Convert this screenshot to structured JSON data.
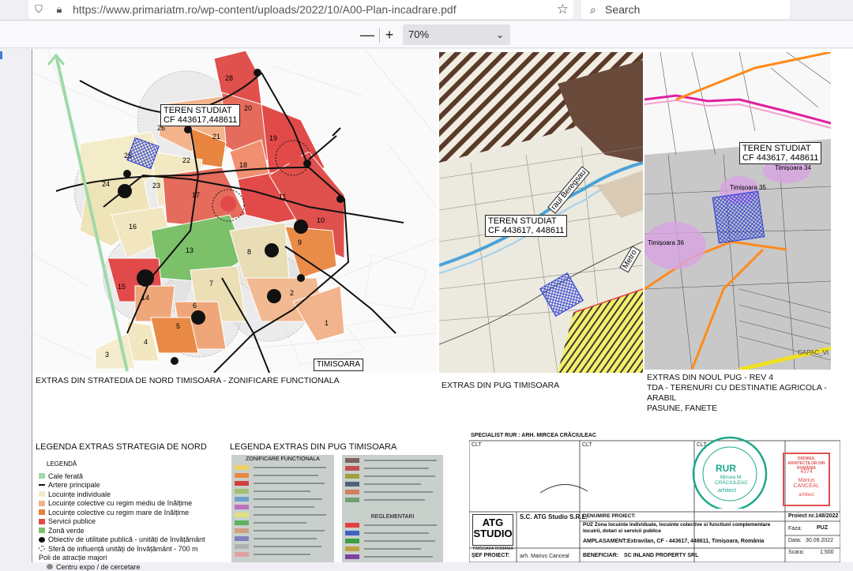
{
  "browser": {
    "url": "https://www.primariatm.ro/wp-content/uploads/2022/10/A00-Plan-incadrare.pdf",
    "search_placeholder": "Search",
    "zoom": "70%",
    "zoom_out": "—",
    "zoom_in": "+"
  },
  "map1": {
    "label_line1": "TEREN STUDIAT",
    "label_line2": "CF 443617,448611",
    "city_label": "TIMISOARA",
    "caption": "EXTRAS DIN STRATEDIA DE NORD TIMISOARA - ZONIFICARE FUNCTIONALA",
    "zones": [
      "28",
      "20",
      "26",
      "21",
      "19",
      "25",
      "22",
      "18",
      "24",
      "23",
      "17",
      "11",
      "16",
      "10",
      "13",
      "8",
      "9",
      "15",
      "14",
      "7",
      "2",
      "6",
      "5",
      "4",
      "3",
      "1"
    ]
  },
  "map2": {
    "label_line1": "TEREN STUDIAT",
    "label_line2": "CF 443617, 448611",
    "river": "raul Beregsau",
    "metro": "Metro",
    "caption": "EXTRAS DIN PUG TIMISOARA"
  },
  "map3": {
    "label_line1": "TEREN STUDIAT",
    "label_line2": "CF 443617, 448611",
    "t34": "Timișoara 34",
    "t35": "Timișoara 35",
    "t36": "Timișoara 36",
    "corner": "CAPAC_VI",
    "caption_line1": "EXTRAS DIN NOUL PUG - REV 4",
    "caption_line2": "TDA - TERENURI CU DESTINATIE AGRICOLA - ARABIL",
    "caption_line3": "PASUNE, FANETE"
  },
  "legend1": {
    "title": "LEGENDA EXTRAS STRATEGIA DE NORD",
    "subtitle": "LEGENDĂ",
    "items": [
      {
        "label": "Cale ferată",
        "color": "#9fd9a9"
      },
      {
        "label": "Artere principale",
        "color": "#111111"
      },
      {
        "label": "Locuințe individuale",
        "color": "#f3ecc8"
      },
      {
        "label": "Locuințe colective cu regim mediu de înălțime",
        "color": "#f2b48c"
      },
      {
        "label": "Locuințe colective cu regim mare de înălțime",
        "color": "#e8823a"
      },
      {
        "label": "Servicii publice",
        "color": "#e24a4a"
      },
      {
        "label": "Zonă verde",
        "color": "#7cc06a"
      },
      {
        "label": "Obiectiv de utilitate publică - unități de învățământ",
        "color": "#111111"
      },
      {
        "label": "Sferă de influență unități de învățământ - 700 m",
        "color": "#cccccc"
      },
      {
        "label": "Poli de atracție majori",
        "color": "#ffffff"
      },
      {
        "label": "Centru expo / de cercetare",
        "color": "#888888"
      }
    ]
  },
  "legend2": {
    "title": "LEGENDA EXTRAS DIN PUG TIMISOARA",
    "heading_a": "ZONIFICARE FUNCTIONALA",
    "heading_b": "REGLEMENTARI"
  },
  "titleblock": {
    "specialist": "SPECIALIST RUR : ARH. MIRCEA CRĂCIULEAC",
    "clt": "CLT",
    "company": "S.C. ATG Studio S.R.L.",
    "company_logo": "ATG STUDIO",
    "company_sub": "TIMISOARA ROMANIA",
    "project_title_label": "DENUMIRE PROIECT:",
    "project_title": "PUZ Zona locuinte individuale, locuinte colective si functiuni complementare locuirii, dotari si servicii publice",
    "location_label": "AMPLASAMENT:",
    "location": "Extravilan, CF - 443617, 448611, Timișoara, România",
    "beneficiary_label": "BENEFICIAR:",
    "beneficiary": "SC INLAND PROPERTY SRL",
    "project_no": "Proiect nr.148/2022",
    "phase_label": "Faza:",
    "phase": "PUZ",
    "date_label": "Data:",
    "date": "30.09.2022",
    "scale_label": "Scara:",
    "scale": "1:500",
    "sef_proiect": "ȘEF PROIECT:",
    "arch": "arh. Marius Canceal",
    "stamp1_line1": "RUR",
    "stamp1_line2": "Mircea M. CRĂCIULEAC",
    "stamp1_line3": "arhitect",
    "stamp2_line1": "ORDINUL ARHITECȚILOR DIN ROMÂNIA",
    "stamp2_line2": "4374",
    "stamp2_line3": "Marius CANCEAL",
    "stamp2_line4": "arhitect"
  }
}
